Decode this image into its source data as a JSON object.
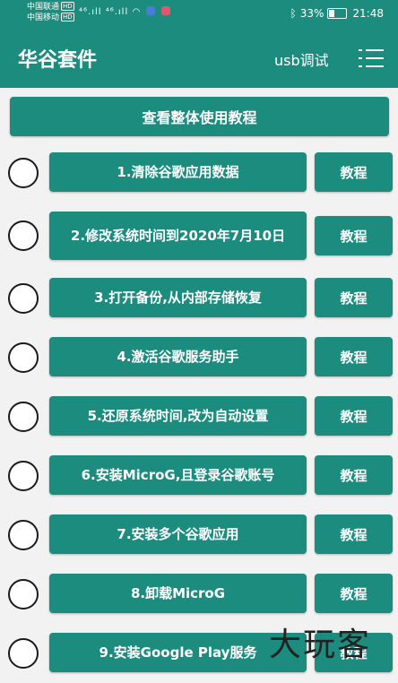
{
  "status_bar": {
    "carrier_1": "中国联通",
    "carrier_2": "中国移动",
    "hd_badge": "HD",
    "signal_text": "⁴⁶.ıll ⁴⁶.ıll",
    "battery_percent": "33%",
    "time": "21:48",
    "app_icon_colors": [
      "#4a7bd8",
      "#e0566a"
    ]
  },
  "app_bar": {
    "title": "华谷套件",
    "usb_debug_label": "usb调试",
    "menu_icon": "list-menu-icon"
  },
  "main": {
    "overall_tutorial_label": "查看整体使用教程",
    "steps": [
      {
        "label": "1.清除谷歌应用数据",
        "tutorial_label": "教程"
      },
      {
        "label": "2.修改系统时间到2020年7月10日",
        "tutorial_label": "教程"
      },
      {
        "label": "3.打开备份,从内部存储恢复",
        "tutorial_label": "教程"
      },
      {
        "label": "4.激活谷歌服务助手",
        "tutorial_label": "教程"
      },
      {
        "label": "5.还原系统时间,改为自动设置",
        "tutorial_label": "教程"
      },
      {
        "label": "6.安装MicroG,且登录谷歌账号",
        "tutorial_label": "教程"
      },
      {
        "label": "7.安装多个谷歌应用",
        "tutorial_label": "教程"
      },
      {
        "label": "8.卸载MicroG",
        "tutorial_label": "教程"
      },
      {
        "label": "9.安装Google Play服务",
        "tutorial_label": "教程"
      }
    ]
  },
  "watermark": "大玩客",
  "colors": {
    "accent": "#1c8c7f",
    "background": "#f2f2f2",
    "text_on_accent": "#ffffff"
  }
}
